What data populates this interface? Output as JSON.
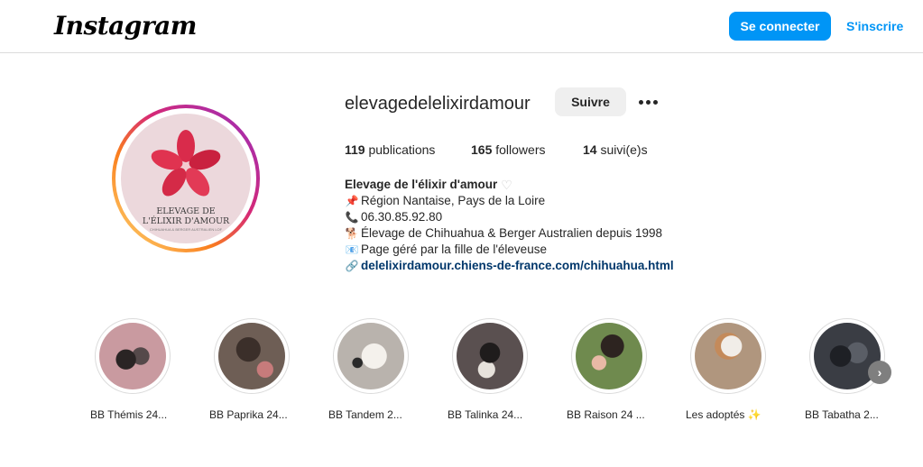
{
  "header": {
    "logo": "Instagram",
    "login_label": "Se connecter",
    "signup_label": "S'inscrire"
  },
  "profile": {
    "avatar": {
      "title": "ELEVAGE DE\nL'ÉLIXIR D'AMOUR",
      "subtitle": "CHIHUAHUA & BERGER AUSTRALIEN LOF"
    },
    "username": "elevagedelelixirdamour",
    "follow_label": "Suivre",
    "stats": {
      "posts_count": "119",
      "posts_label": "publications",
      "followers_count": "165",
      "followers_label": "followers",
      "following_count": "14",
      "following_label": "suivi(e)s"
    },
    "bio": {
      "full_name": "Elevage de l'élixir d'amour",
      "lines": [
        {
          "icon": "pushpin-icon",
          "text": "Région Nantaise, Pays de la Loire"
        },
        {
          "icon": "telephone-icon",
          "text": "06.30.85.92.80"
        },
        {
          "icon": "dog-icon",
          "text": "Élevage de Chihuahua & Berger Australien depuis 1998"
        },
        {
          "icon": "email-icon",
          "text": "Page géré par la fille de l'éleveuse"
        }
      ],
      "link": "delelixirdamour.chiens-de-france.com/chihuahua.html"
    }
  },
  "highlights": [
    {
      "label": "BB Thémis 24...",
      "color": "#c99aa0"
    },
    {
      "label": "BB Paprika 24...",
      "color": "#6e5e55"
    },
    {
      "label": "BB Tandem 2...",
      "color": "#b9b3ad"
    },
    {
      "label": "BB Talinka 24...",
      "color": "#5a5050"
    },
    {
      "label": "BB Raison 24 ...",
      "color": "#6f8a4e"
    },
    {
      "label": "Les adoptés ✨",
      "color": "#b0967e"
    },
    {
      "label": "BB Tabatha 2...",
      "color": "#3a3d44"
    }
  ],
  "colors": {
    "primary_button": "#0095f6",
    "link": "#00376b",
    "secondary_button": "#efefef"
  }
}
